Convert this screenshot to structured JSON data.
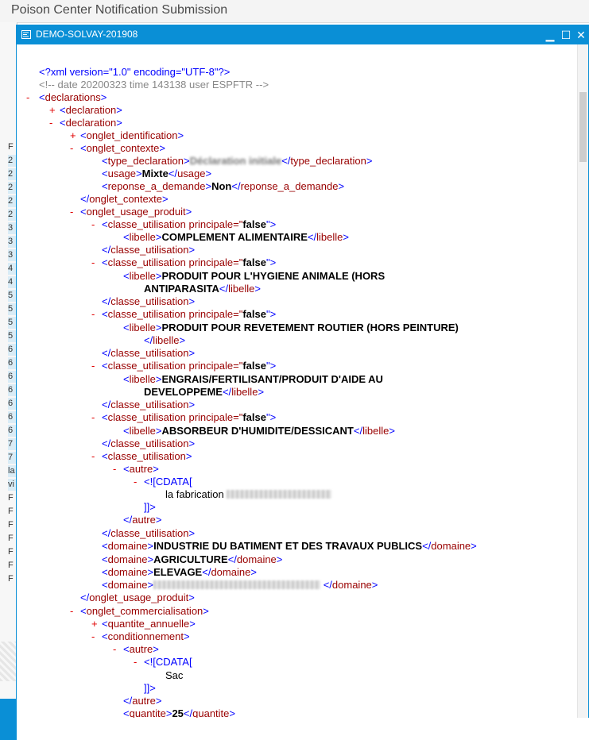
{
  "app": {
    "title": "Poison Center Notification Submission"
  },
  "background_rows": [
    "F",
    "2",
    "2",
    "2",
    "2",
    "2",
    "3",
    "3",
    "3",
    "4",
    "4",
    "5",
    "5",
    "5",
    "5",
    "6",
    "6",
    "6",
    "6",
    "6",
    "6",
    "6",
    "7",
    "7",
    "la",
    "vi",
    "F",
    "F",
    "F",
    "F",
    "F",
    "F",
    "F"
  ],
  "window": {
    "title": "DEMO-SOLVAY-201908",
    "minimize": "▁",
    "maximize": "☐",
    "close": "✕"
  },
  "xml": {
    "l01": {
      "p1": "<?",
      "p2": "xml version=\"1.0\" encoding=\"UTF-8\"",
      "p3": "?>"
    },
    "l02": {
      "t": "<!-- date 20200323 time 143138 user ESPFTR -->"
    },
    "l03": {
      "tg": "-",
      "o": "<",
      "n": "declarations",
      "c": ">"
    },
    "l04": {
      "tg": "+",
      "o": "<",
      "n": "declaration",
      "c": ">"
    },
    "l05": {
      "tg": "-",
      "o": "<",
      "n": "declaration",
      "c": ">"
    },
    "l06": {
      "tg": "+",
      "o": "<",
      "n": "onglet_identification",
      "c": ">"
    },
    "l07": {
      "tg": "-",
      "o": "<",
      "n": "onglet_contexte",
      "c": ">"
    },
    "l08": {
      "o": "<",
      "n": "type_declaration",
      "c": ">",
      "v": "Déclaration initiale",
      "eo": "</",
      "en": "type_declaration",
      "ec": ">"
    },
    "l09": {
      "o": "<",
      "n": "usage",
      "c": ">",
      "v": "Mixte",
      "eo": "</",
      "en": "usage",
      "ec": ">"
    },
    "l10": {
      "o": "<",
      "n": "reponse_a_demande",
      "c": ">",
      "v": "Non",
      "eo": "</",
      "en": "reponse_a_demande",
      "ec": ">"
    },
    "l11": {
      "o": "</",
      "n": "onglet_contexte",
      "c": ">"
    },
    "l12": {
      "tg": "-",
      "o": "<",
      "n": "onglet_usage_produit",
      "c": ">"
    },
    "l13": {
      "tg": "-",
      "o": "<",
      "n": "classe_utilisation",
      "a": " principale=\"",
      "av": "false",
      "ac": "\">"
    },
    "l14": {
      "o": "<",
      "n": "libelle",
      "c": ">",
      "v": "COMPLEMENT ALIMENTAIRE",
      "eo": "</",
      "en": "libelle",
      "ec": ">"
    },
    "l15": {
      "o": "</",
      "n": "classe_utilisation",
      "c": ">"
    },
    "l16": {
      "tg": "-",
      "o": "<",
      "n": "classe_utilisation",
      "a": " principale=\"",
      "av": "false",
      "ac": "\">"
    },
    "l17": {
      "o": "<",
      "n": "libelle",
      "c": ">",
      "v": "PRODUIT POUR L'HYGIENE ANIMALE (HORS"
    },
    "l18": {
      "v": "ANTIPARASITA",
      "eo": "</",
      "en": "libelle",
      "ec": ">"
    },
    "l19": {
      "o": "</",
      "n": "classe_utilisation",
      "c": ">"
    },
    "l20": {
      "tg": "-",
      "o": "<",
      "n": "classe_utilisation",
      "a": " principale=\"",
      "av": "false",
      "ac": "\">"
    },
    "l21": {
      "o": "<",
      "n": "libelle",
      "c": ">",
      "v": "PRODUIT POUR REVETEMENT ROUTIER (HORS PEINTURE)"
    },
    "l22": {
      "eo": "</",
      "en": "libelle",
      "ec": ">"
    },
    "l23": {
      "o": "</",
      "n": "classe_utilisation",
      "c": ">"
    },
    "l24": {
      "tg": "-",
      "o": "<",
      "n": "classe_utilisation",
      "a": " principale=\"",
      "av": "false",
      "ac": "\">"
    },
    "l25": {
      "o": "<",
      "n": "libelle",
      "c": ">",
      "v": "ENGRAIS/FERTILISANT/PRODUIT D'AIDE AU"
    },
    "l26": {
      "v": "DEVELOPPEME",
      "eo": "</",
      "en": "libelle",
      "ec": ">"
    },
    "l27": {
      "o": "</",
      "n": "classe_utilisation",
      "c": ">"
    },
    "l28": {
      "tg": "-",
      "o": "<",
      "n": "classe_utilisation",
      "a": " principale=\"",
      "av": "false",
      "ac": "\">"
    },
    "l29": {
      "o": "<",
      "n": "libelle",
      "c": ">",
      "v": "ABSORBEUR D'HUMIDITE/DESSICANT",
      "eo": "</",
      "en": "libelle",
      "ec": ">"
    },
    "l30": {
      "o": "</",
      "n": "classe_utilisation",
      "c": ">"
    },
    "l31": {
      "tg": "-",
      "o": "<",
      "n": "classe_utilisation",
      "c": ">"
    },
    "l32": {
      "tg": "-",
      "o": "<",
      "n": "autre",
      "c": ">"
    },
    "l33": {
      "tg": "-",
      "t": "<![CDATA["
    },
    "l34": {
      "t": "la fabrication"
    },
    "l35": {
      "t": "]]>"
    },
    "l36": {
      "o": "</",
      "n": "autre",
      "c": ">"
    },
    "l37": {
      "o": "</",
      "n": "classe_utilisation",
      "c": ">"
    },
    "l38": {
      "o": "<",
      "n": "domaine",
      "c": ">",
      "v": "INDUSTRIE DU BATIMENT ET DES TRAVAUX PUBLICS",
      "eo": "</",
      "en": "domaine",
      "ec": ">"
    },
    "l39": {
      "o": "<",
      "n": "domaine",
      "c": ">",
      "v": "AGRICULTURE",
      "eo": "</",
      "en": "domaine",
      "ec": ">"
    },
    "l40": {
      "o": "<",
      "n": "domaine",
      "c": ">",
      "v": "ELEVAGE",
      "eo": "</",
      "en": "domaine",
      "ec": ">"
    },
    "l41": {
      "o": "<",
      "n": "domaine",
      "c": ">",
      "eo": "</",
      "en": "domaine",
      "ec": ">"
    },
    "l42": {
      "o": "</",
      "n": "onglet_usage_produit",
      "c": ">"
    },
    "l43": {
      "tg": "-",
      "o": "<",
      "n": "onglet_commercialisation",
      "c": ">"
    },
    "l44": {
      "tg": "+",
      "o": "<",
      "n": "quantite_annuelle",
      "c": ">"
    },
    "l45": {
      "tg": "-",
      "o": "<",
      "n": "conditionnement",
      "c": ">"
    },
    "l46": {
      "tg": "-",
      "o": "<",
      "n": "autre",
      "c": ">"
    },
    "l47": {
      "tg": "-",
      "t": "<![CDATA["
    },
    "l48": {
      "t": "Sac"
    },
    "l49": {
      "t": "]]>"
    },
    "l50": {
      "o": "</",
      "n": "autre",
      "c": ">"
    },
    "l51": {
      "o": "<",
      "n": "quantite",
      "c": ">",
      "v": "25",
      "eo": "</",
      "en": "quantite",
      "ec": ">"
    }
  }
}
